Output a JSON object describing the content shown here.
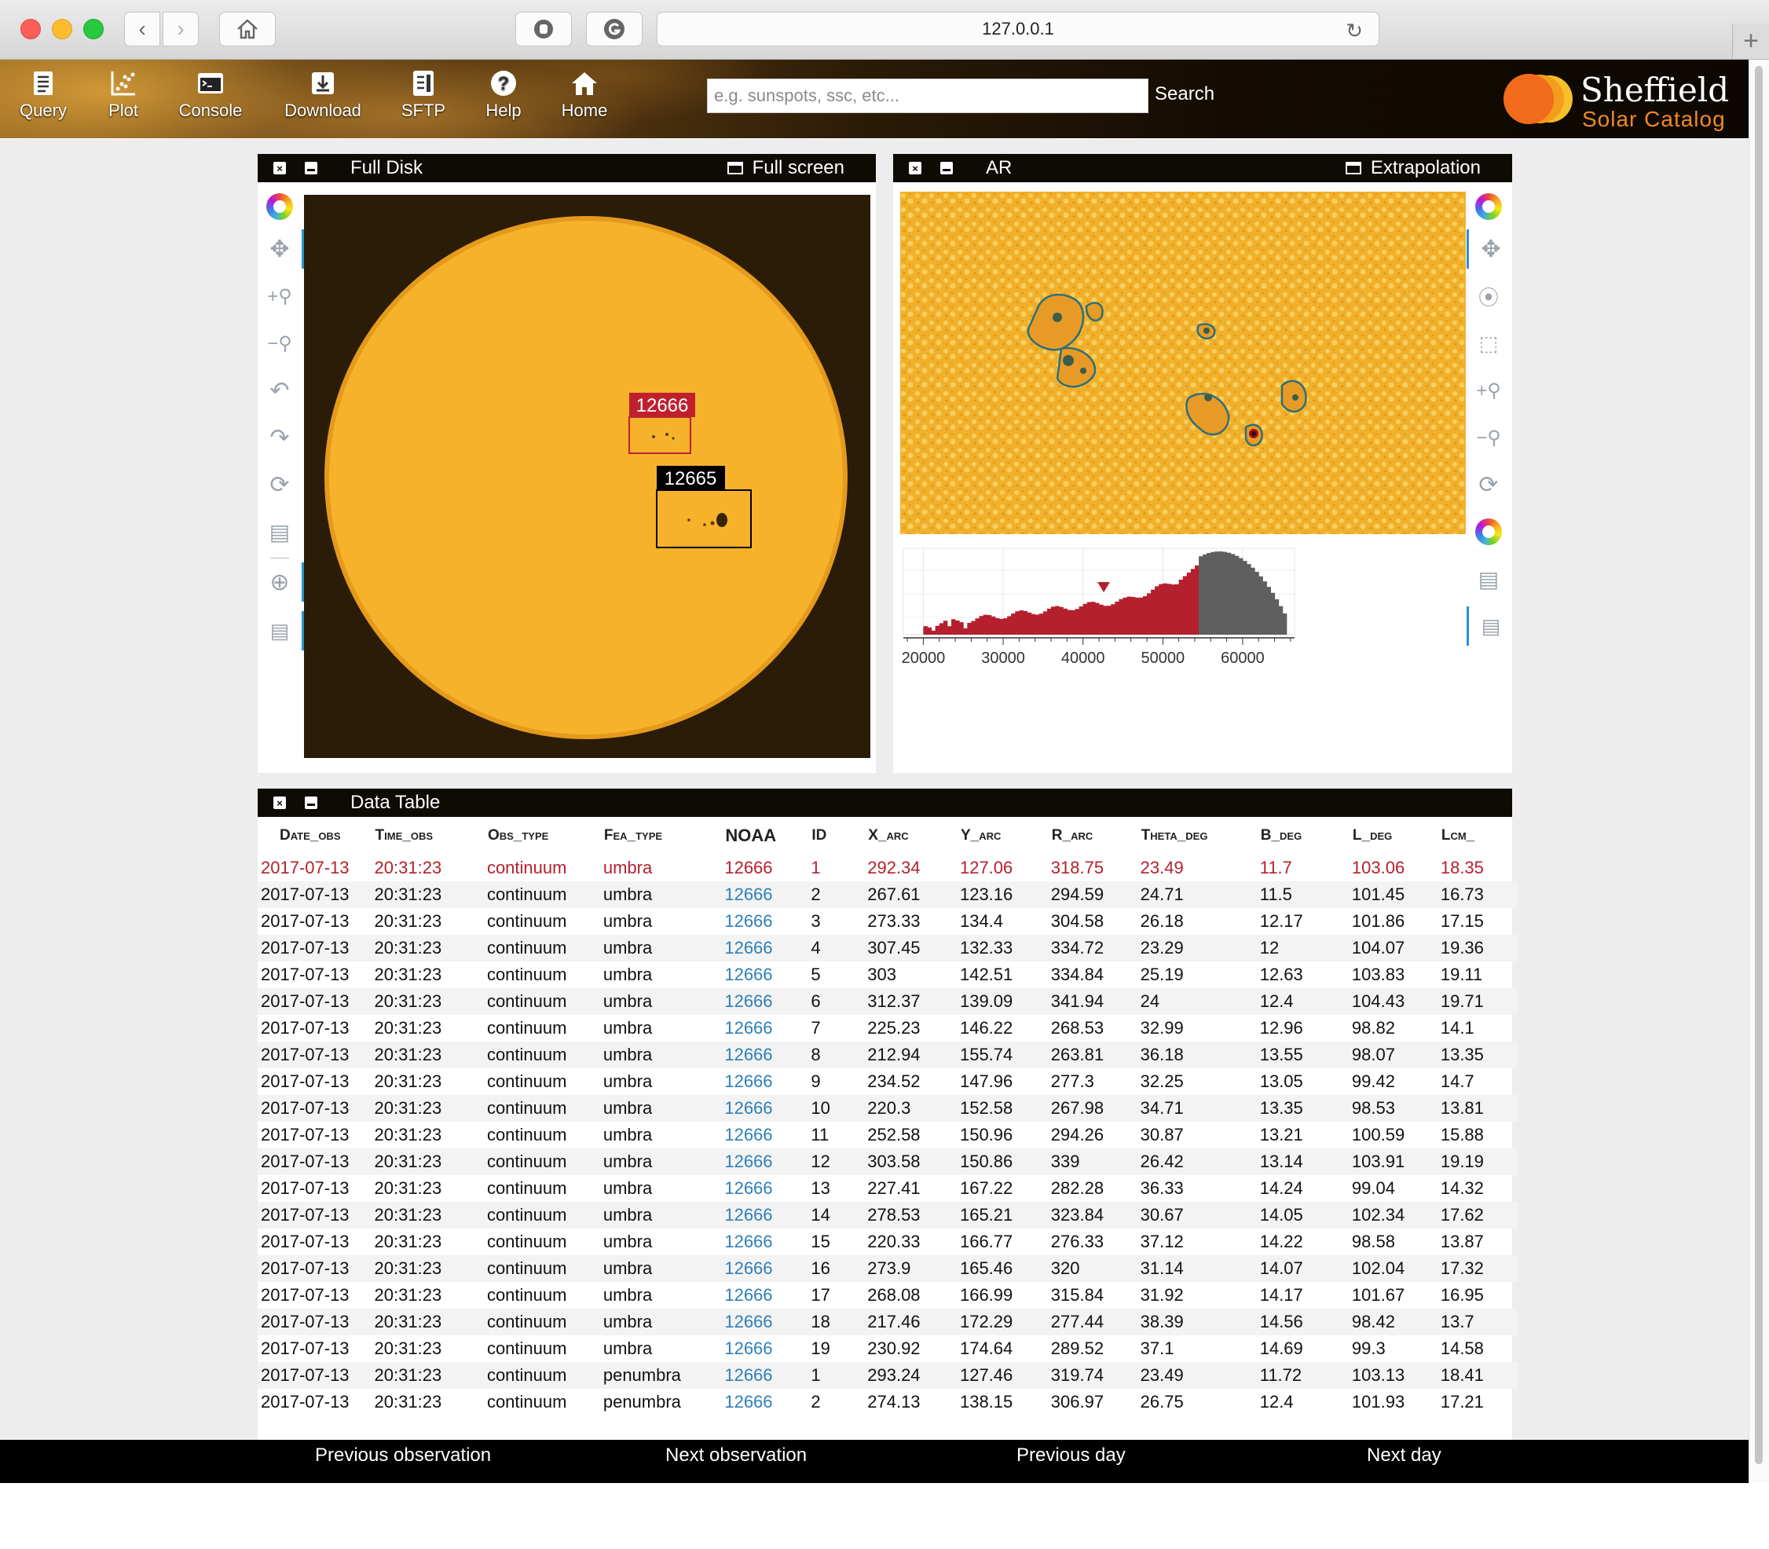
{
  "browser": {
    "url": "127.0.0.1"
  },
  "nav": {
    "items": [
      {
        "label": "Query",
        "icon": "document-icon"
      },
      {
        "label": "Plot",
        "icon": "scatter-plot-icon"
      },
      {
        "label": "Console",
        "icon": "terminal-icon"
      },
      {
        "label": "Download",
        "icon": "download-icon"
      },
      {
        "label": "SFTP",
        "icon": "server-icon"
      },
      {
        "label": "Help",
        "icon": "question-icon"
      },
      {
        "label": "Home",
        "icon": "home-icon"
      }
    ],
    "search_placeholder": "e.g. sunspots, ssc, etc...",
    "search_label": "Search",
    "brand_line1": "Sheffield",
    "brand_line2": "Solar Catalog",
    "brand_colors": [
      "#f5c02a",
      "#f49c1c",
      "#f26a1b"
    ]
  },
  "full_disk": {
    "title": "Full Disk",
    "action": "Full screen",
    "regions": [
      {
        "label": "12666",
        "color": "#c0202e"
      },
      {
        "label": "12665",
        "color": "#000000"
      }
    ]
  },
  "ar": {
    "title": "AR",
    "action": "Extrapolation"
  },
  "histogram": {
    "type": "bar",
    "x_ticks": [
      "20000",
      "30000",
      "40000",
      "50000",
      "60000"
    ],
    "xlim": [
      17500,
      66500
    ],
    "threshold": 54200,
    "marker": 42600,
    "colors": {
      "below": "#b5202e",
      "above": "#5f5f5f",
      "marker": "#b5202e"
    }
  },
  "data_table": {
    "title": "Data Table",
    "columns": [
      "Date_obs",
      "Time_obs",
      "Obs_type",
      "Fea_type",
      "NOAA",
      "ID",
      "X_arc",
      "Y_arc",
      "R_arc",
      "Theta_deg",
      "B_deg",
      "L_deg",
      "Lcm_"
    ],
    "rows": [
      [
        "2017-07-13",
        "20:31:23",
        "continuum",
        "umbra",
        "12666",
        "1",
        "292.34",
        "127.06",
        "318.75",
        "23.49",
        "11.7",
        "103.06",
        "18.35"
      ],
      [
        "2017-07-13",
        "20:31:23",
        "continuum",
        "umbra",
        "12666",
        "2",
        "267.61",
        "123.16",
        "294.59",
        "24.71",
        "11.5",
        "101.45",
        "16.73"
      ],
      [
        "2017-07-13",
        "20:31:23",
        "continuum",
        "umbra",
        "12666",
        "3",
        "273.33",
        "134.4",
        "304.58",
        "26.18",
        "12.17",
        "101.86",
        "17.15"
      ],
      [
        "2017-07-13",
        "20:31:23",
        "continuum",
        "umbra",
        "12666",
        "4",
        "307.45",
        "132.33",
        "334.72",
        "23.29",
        "12",
        "104.07",
        "19.36"
      ],
      [
        "2017-07-13",
        "20:31:23",
        "continuum",
        "umbra",
        "12666",
        "5",
        "303",
        "142.51",
        "334.84",
        "25.19",
        "12.63",
        "103.83",
        "19.11"
      ],
      [
        "2017-07-13",
        "20:31:23",
        "continuum",
        "umbra",
        "12666",
        "6",
        "312.37",
        "139.09",
        "341.94",
        "24",
        "12.4",
        "104.43",
        "19.71"
      ],
      [
        "2017-07-13",
        "20:31:23",
        "continuum",
        "umbra",
        "12666",
        "7",
        "225.23",
        "146.22",
        "268.53",
        "32.99",
        "12.96",
        "98.82",
        "14.1"
      ],
      [
        "2017-07-13",
        "20:31:23",
        "continuum",
        "umbra",
        "12666",
        "8",
        "212.94",
        "155.74",
        "263.81",
        "36.18",
        "13.55",
        "98.07",
        "13.35"
      ],
      [
        "2017-07-13",
        "20:31:23",
        "continuum",
        "umbra",
        "12666",
        "9",
        "234.52",
        "147.96",
        "277.3",
        "32.25",
        "13.05",
        "99.42",
        "14.7"
      ],
      [
        "2017-07-13",
        "20:31:23",
        "continuum",
        "umbra",
        "12666",
        "10",
        "220.3",
        "152.58",
        "267.98",
        "34.71",
        "13.35",
        "98.53",
        "13.81"
      ],
      [
        "2017-07-13",
        "20:31:23",
        "continuum",
        "umbra",
        "12666",
        "11",
        "252.58",
        "150.96",
        "294.26",
        "30.87",
        "13.21",
        "100.59",
        "15.88"
      ],
      [
        "2017-07-13",
        "20:31:23",
        "continuum",
        "umbra",
        "12666",
        "12",
        "303.58",
        "150.86",
        "339",
        "26.42",
        "13.14",
        "103.91",
        "19.19"
      ],
      [
        "2017-07-13",
        "20:31:23",
        "continuum",
        "umbra",
        "12666",
        "13",
        "227.41",
        "167.22",
        "282.28",
        "36.33",
        "14.24",
        "99.04",
        "14.32"
      ],
      [
        "2017-07-13",
        "20:31:23",
        "continuum",
        "umbra",
        "12666",
        "14",
        "278.53",
        "165.21",
        "323.84",
        "30.67",
        "14.05",
        "102.34",
        "17.62"
      ],
      [
        "2017-07-13",
        "20:31:23",
        "continuum",
        "umbra",
        "12666",
        "15",
        "220.33",
        "166.77",
        "276.33",
        "37.12",
        "14.22",
        "98.58",
        "13.87"
      ],
      [
        "2017-07-13",
        "20:31:23",
        "continuum",
        "umbra",
        "12666",
        "16",
        "273.9",
        "165.46",
        "320",
        "31.14",
        "14.07",
        "102.04",
        "17.32"
      ],
      [
        "2017-07-13",
        "20:31:23",
        "continuum",
        "umbra",
        "12666",
        "17",
        "268.08",
        "166.99",
        "315.84",
        "31.92",
        "14.17",
        "101.67",
        "16.95"
      ],
      [
        "2017-07-13",
        "20:31:23",
        "continuum",
        "umbra",
        "12666",
        "18",
        "217.46",
        "172.29",
        "277.44",
        "38.39",
        "14.56",
        "98.42",
        "13.7"
      ],
      [
        "2017-07-13",
        "20:31:23",
        "continuum",
        "umbra",
        "12666",
        "19",
        "230.92",
        "174.64",
        "289.52",
        "37.1",
        "14.69",
        "99.3",
        "14.58"
      ],
      [
        "2017-07-13",
        "20:31:23",
        "continuum",
        "penumbra",
        "12666",
        "1",
        "293.24",
        "127.46",
        "319.74",
        "23.49",
        "11.72",
        "103.13",
        "18.41"
      ],
      [
        "2017-07-13",
        "20:31:23",
        "continuum",
        "penumbra",
        "12666",
        "2",
        "274.13",
        "138.15",
        "306.97",
        "26.75",
        "12.4",
        "101.93",
        "17.21"
      ]
    ]
  },
  "footer": {
    "prev_obs": "Previous observation",
    "next_obs": "Next observation",
    "prev_day": "Previous day",
    "next_day": "Next day"
  }
}
